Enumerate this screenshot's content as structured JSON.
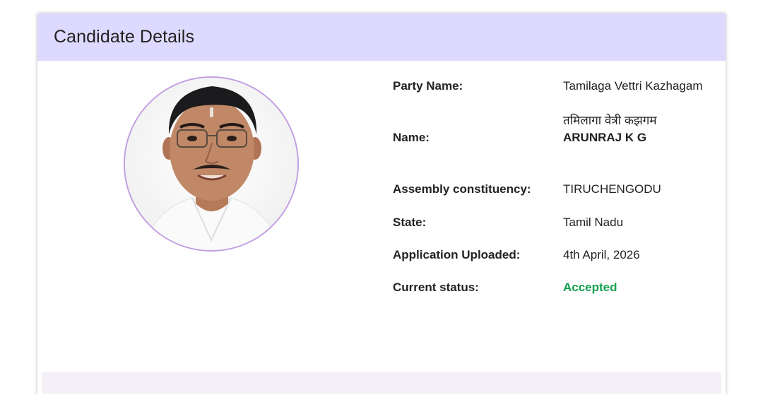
{
  "card": {
    "title": "Candidate Details"
  },
  "details": {
    "party_name_label": "Party Name:",
    "party_name_value": "Tamilaga Vettri Kazhagam",
    "name_label": "Name:",
    "name_hindi": "तमिलागा वेत्री कझगम",
    "name_value": "ARUNRAJ K G",
    "constituency_label": "Assembly constituency:",
    "constituency_value": "TIRUCHENGODU",
    "state_label": "State:",
    "state_value": "Tamil Nadu",
    "uploaded_label": "Application Uploaded:",
    "uploaded_value": "4th April, 2026",
    "status_label": "Current status:",
    "status_value": "Accepted"
  },
  "colors": {
    "header_bg": "#dedaff",
    "photo_border": "#c29ee2",
    "status_accepted": "#12a04e"
  }
}
